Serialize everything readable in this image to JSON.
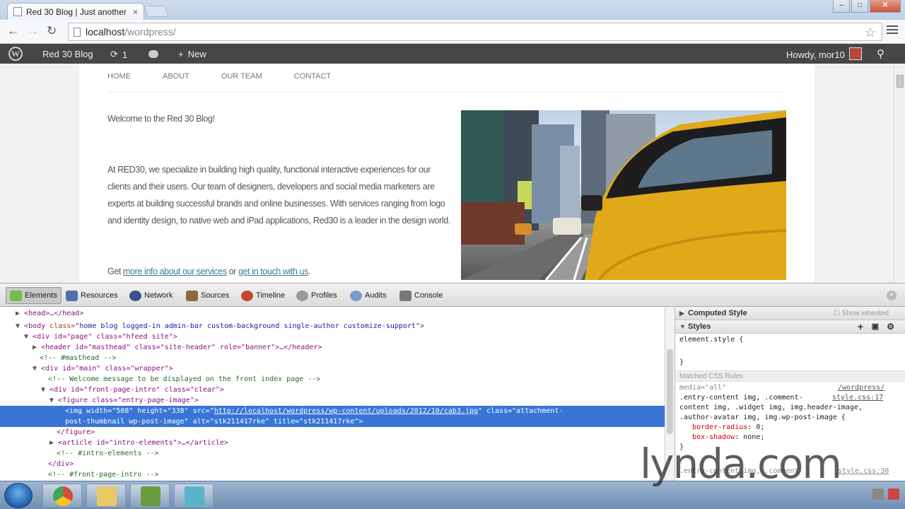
{
  "browser": {
    "tab_title": "Red 30 Blog | Just another",
    "tab_close": "×",
    "url_host": "localhost",
    "url_path": "/wordpress/",
    "back": "←",
    "forward": "→",
    "reload": "↻",
    "star": "☆"
  },
  "adminbar": {
    "logo": "W",
    "site_name": "Red 30 Blog",
    "updates_count": "1",
    "updates_icon": "⟳",
    "new_label": "New",
    "new_icon": "+",
    "howdy": "Howdy, mor10",
    "search_icon": "⚲"
  },
  "site": {
    "nav": [
      "HOME",
      "ABOUT",
      "OUR TEAM",
      "CONTACT"
    ],
    "welcome": "Welcome to the Red 30 Blog!",
    "body": "At RED30, we specialize in building high quality, functional interactive experiences for our clients and their users. Our team of designers, developers and social media marketers are experts at building successful brands and online businesses. With services ranging from logo and identity design, to native web and iPad applications, Red30 is a leader in the design world.",
    "get_prefix": "Get ",
    "link_services": "more info about our services",
    "get_or": " or ",
    "link_touch": "get in touch with us",
    "get_suffix": "."
  },
  "devtools": {
    "tabs": [
      "Elements",
      "Resources",
      "Network",
      "Sources",
      "Timeline",
      "Profiles",
      "Audits",
      "Console"
    ],
    "active_tab": "Elements",
    "close": "×",
    "dom": {
      "l1": "<head>…</head>",
      "l2_tag": "<body",
      "l2_attr": " class=",
      "l2_val": "\"home blog logged-in admin-bar custom-background single-author customize-support\"",
      "l2_end": ">",
      "l3": "<div id=\"page\" class=\"hfeed site\">",
      "l4": "<header id=\"masthead\" class=\"site-header\" role=\"banner\">…</header>",
      "l5": "<!-- #masthead -->",
      "l6": "<div id=\"main\" class=\"wrapper\">",
      "l7": "<!-- Welcome message to be displayed on the front index page -->",
      "l8": "<div id=\"front-page-intro\" class=\"clear\">",
      "l9": "<figure class=\"entry-page-image\">",
      "l10_a": "<img width=\"508\" height=\"338\" src=\"",
      "l10_link": "http://localhost/wordpress/wp-content/uploads/2012/10/cab3.jpg",
      "l10_b": "\" class=\"attachment-",
      "l11": "post-thumbnail wp-post-image\" alt=\"stk211417rke\" title=\"stk211417rke\">",
      "l12": "</figure>",
      "l13": "<article id=\"intro-elements\">…</article>",
      "l14": "<!-- #intro-elements -->",
      "l15": "</div>",
      "l16": "<!-- #front-page-intro -->"
    },
    "sidebar": {
      "computed_style": "Computed Style",
      "show_inherited": "Show inherited",
      "styles": "Styles",
      "element_style": "element.style {",
      "close_brace": "}",
      "matched_rules": "Matched CSS Rules",
      "media": "media=\"all\"",
      "source_link": "/wordpress/",
      "source_file": "style.css:17",
      "selector_1": ".entry-content img, .comment-",
      "selector_2": "content img, .widget img, img.header-image,",
      "selector_3": ".author-avatar img, img.wp-post-image {",
      "prop_1_name": "border-radius",
      "prop_1_val": "0;",
      "prop_2_name": "box-shadow",
      "prop_2_val": "none;",
      "selector_4": ".entry-content img, .comment-",
      "source_file_2": "style.css:30"
    }
  },
  "watermark": "lynda.com"
}
